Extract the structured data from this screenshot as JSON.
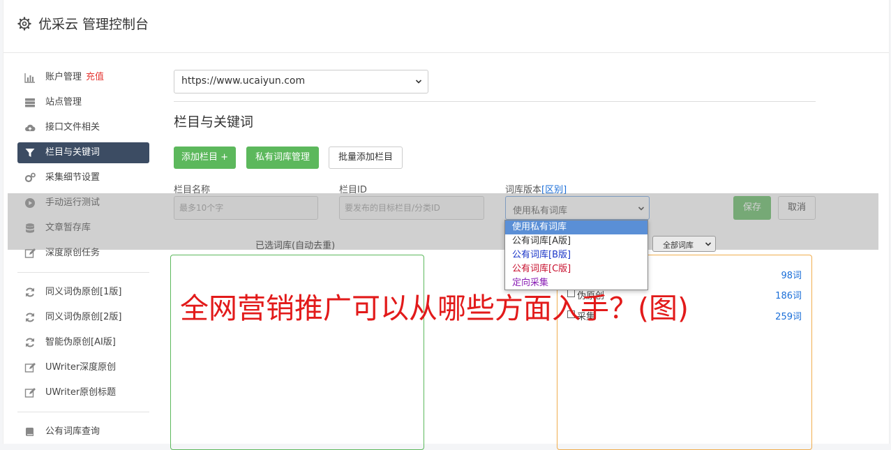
{
  "header": {
    "title": "优采云 管理控制台"
  },
  "sidebar": {
    "group1": [
      {
        "label": "账户管理",
        "badge": "充值",
        "icon": "bar-chart-icon"
      },
      {
        "label": "站点管理",
        "icon": "server-icon"
      },
      {
        "label": "接口文件相关",
        "icon": "cloud-upload-icon"
      },
      {
        "label": "栏目与关键词",
        "icon": "filter-icon",
        "active": true
      },
      {
        "label": "采集细节设置",
        "icon": "gears-icon"
      },
      {
        "label": "手动运行测试",
        "icon": "play-icon"
      },
      {
        "label": "文章暂存库",
        "icon": "database-icon"
      },
      {
        "label": "深度原创任务",
        "icon": "edit-icon"
      }
    ],
    "group2": [
      {
        "label": "同义词伪原创[1版]",
        "icon": "refresh-icon"
      },
      {
        "label": "同义词伪原创[2版]",
        "icon": "refresh-icon"
      },
      {
        "label": "智能伪原创[AI版]",
        "icon": "refresh-icon"
      },
      {
        "label": "UWriter深度原创",
        "icon": "edit-icon"
      },
      {
        "label": "UWriter原创标题",
        "icon": "edit-icon"
      }
    ],
    "group3": [
      {
        "label": "公有词库查询",
        "icon": "book-icon"
      }
    ]
  },
  "main": {
    "site_select": {
      "value": "https://www.ucaiyun.com"
    },
    "section_title": "栏目与关键词",
    "buttons": {
      "add_column": "添加栏目 +",
      "private_lib": "私有词库管理",
      "batch_add": "批量添加栏目"
    },
    "form": {
      "name_label": "栏目名称",
      "name_placeholder": "最多10个字",
      "id_label": "栏目ID",
      "id_placeholder": "要发布的目标栏目/分类ID",
      "version_label": "词库版本",
      "version_link": "[区别]",
      "version_value": "使用私有词库",
      "save": "保存",
      "cancel": "取消"
    },
    "dropdown_options": [
      {
        "label": "使用私有词库",
        "color": "#ffffff",
        "selected": true
      },
      {
        "label": "公有词库[A版]",
        "color": "#333333"
      },
      {
        "label": "公有词库[B版]",
        "color": "#1a35c8"
      },
      {
        "label": "公有词库[C版]",
        "color": "#c8102e"
      },
      {
        "label": "定向采集",
        "color": "#8a1fb5"
      }
    ],
    "selected_label": "已选词库(自动去重)",
    "filter_value": "全部词库",
    "libraries": [
      {
        "name": "",
        "count": "98词"
      },
      {
        "name": "伪原创",
        "count": "186词"
      },
      {
        "name": "采集",
        "count": "259词"
      }
    ]
  },
  "watermark": "全网营销推广可以从哪些方面入手？(图)",
  "colors": {
    "green": "#5cb85c",
    "sidebar_active": "#3c4c63",
    "badge": "#e53935",
    "link": "#1a6ed8",
    "watermark": "#e21a1a"
  }
}
